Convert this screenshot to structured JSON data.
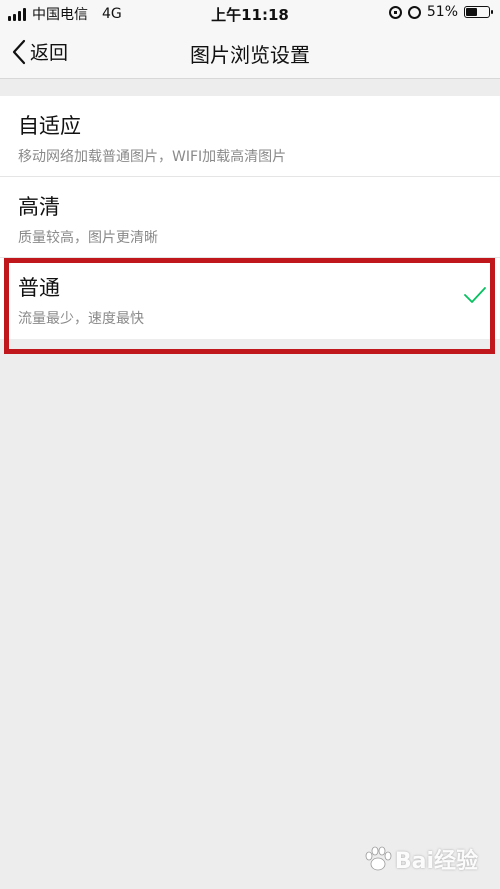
{
  "status_bar": {
    "carrier": "中国电信",
    "network": "4G",
    "time": "上午11:18",
    "battery": "51%",
    "battery_level": 0.51
  },
  "nav": {
    "back_label": "返回",
    "title": "图片浏览设置"
  },
  "options": [
    {
      "title": "自适应",
      "subtitle": "移动网络加载普通图片，WIFI加载高清图片",
      "selected": false
    },
    {
      "title": "高清",
      "subtitle": "质量较高，图片更清晰",
      "selected": false
    },
    {
      "title": "普通",
      "subtitle": "流量最少，速度最快",
      "selected": true
    }
  ],
  "colors": {
    "check": "#07c160",
    "highlight": "#c0171c"
  },
  "watermark": {
    "text": "Bai经验"
  }
}
